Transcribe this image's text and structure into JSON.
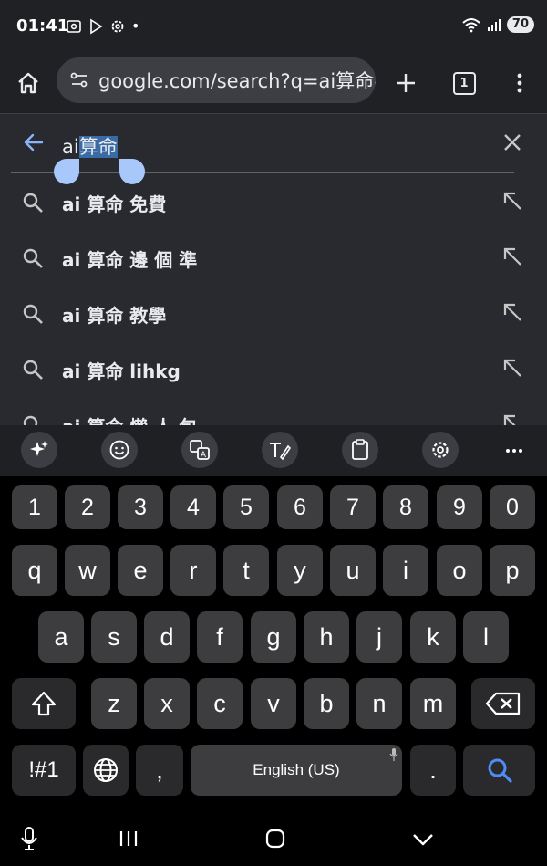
{
  "status_bar": {
    "time": "01:41",
    "dot": "•",
    "battery": "70",
    "icons": [
      "screenshot-icon",
      "play-store-icon",
      "settings-icon",
      "wifi-icon",
      "signal-icon"
    ]
  },
  "toolbar": {
    "url": "google.com/search?q=ai算命&c",
    "tab_count": "1"
  },
  "search": {
    "query_plain": "ai",
    "query_selected": "算命"
  },
  "suggestions": [
    "ai 算命 免費",
    "ai 算命 邊 個 準",
    "ai 算命 教學",
    "ai 算命 lihkg",
    "ai 算命 懶 人 包"
  ],
  "keyboard": {
    "number_row": [
      "1",
      "2",
      "3",
      "4",
      "5",
      "6",
      "7",
      "8",
      "9",
      "0"
    ],
    "row1": [
      "q",
      "w",
      "e",
      "r",
      "t",
      "y",
      "u",
      "i",
      "o",
      "p"
    ],
    "row2": [
      "a",
      "s",
      "d",
      "f",
      "g",
      "h",
      "j",
      "k",
      "l"
    ],
    "row3": [
      "z",
      "x",
      "c",
      "v",
      "b",
      "n",
      "m"
    ],
    "symbols_key": "!#1",
    "comma": ",",
    "period": ".",
    "space_label": "English (US)"
  },
  "colors": {
    "accent": "#a8c7fa",
    "selection": "#3b6ba5",
    "search_key": "#4c8df6"
  }
}
